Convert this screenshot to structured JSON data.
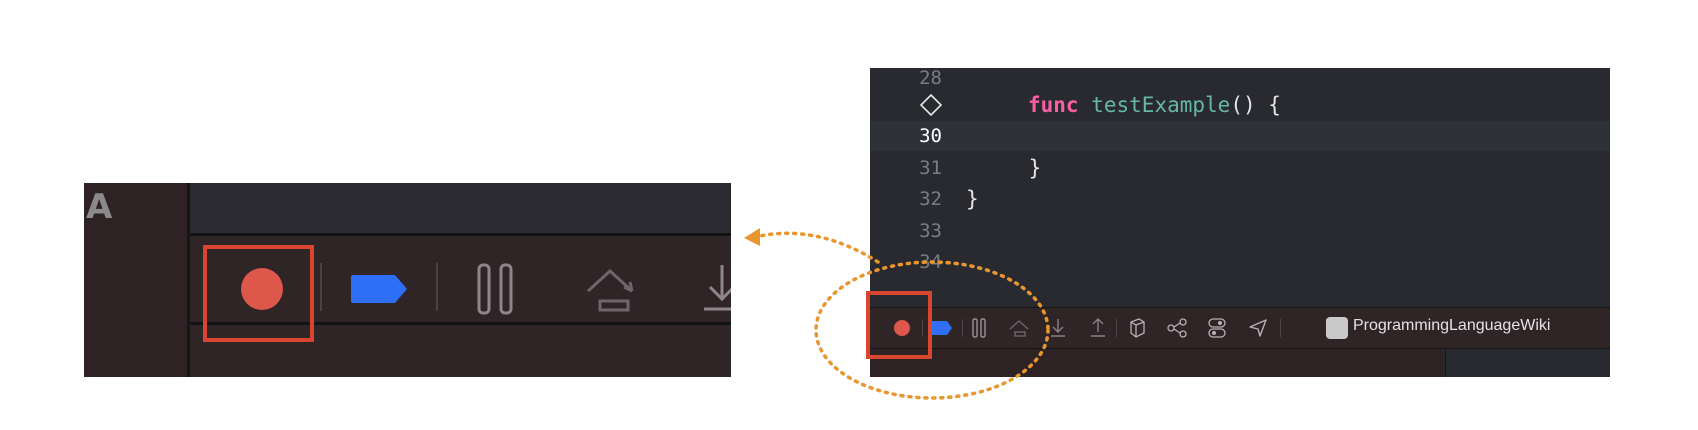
{
  "zoom_panel": {
    "gutter_letter": "A"
  },
  "editor": {
    "lines": [
      {
        "number": "28",
        "text": ""
      },
      {
        "number": "",
        "keyword": "func",
        "name": "testExample",
        "rest": "() {"
      },
      {
        "number": "30",
        "text": ""
      },
      {
        "number": "31",
        "text": "    }"
      },
      {
        "number": "32",
        "text": "}"
      },
      {
        "number": "33",
        "text": ""
      },
      {
        "number": "34",
        "text": ""
      }
    ]
  },
  "debug_bar": {
    "scheme_name": "ProgrammingLanguageWiki"
  },
  "colors": {
    "record_red": "#dd584a",
    "breakpoint_blue": "#2f6ef6",
    "highlight_red": "#d9452f",
    "callout_orange": "#e8962e"
  },
  "icons": [
    "record-button-icon",
    "breakpoint-toggle-icon",
    "pause-icon",
    "step-over-icon",
    "step-into-icon",
    "step-out-icon",
    "view-hierarchy-icon",
    "memory-graph-icon",
    "environment-overrides-icon",
    "simulate-location-icon",
    "scheme-app-icon"
  ]
}
